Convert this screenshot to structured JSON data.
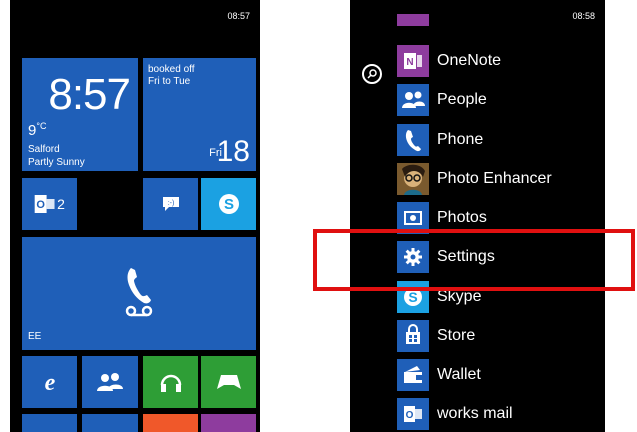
{
  "start_screen": {
    "status_time": "08:57",
    "clock_tile": {
      "time": "8:57",
      "temperature": "9",
      "temp_unit": "°C",
      "city": "Salford",
      "condition": "Partly Sunny"
    },
    "calendar_tile": {
      "line1": "booked off",
      "line2": "Fri to Tue",
      "day": "Fri",
      "date": "18"
    },
    "mail_tile": {
      "count": "2",
      "icon": "outlook-mail-icon"
    },
    "messaging_tile": {
      "icon": "messaging-icon"
    },
    "skype_tile": {
      "icon": "skype-icon"
    },
    "phone_tile": {
      "carrier": "EE",
      "icon": "phone-voicemail-icon"
    },
    "bottom_tiles": [
      "internet-explorer-icon",
      "people-icon",
      "music-headphones-icon",
      "games-controller-icon"
    ]
  },
  "app_list": {
    "status_time": "08:58",
    "apps": [
      {
        "label": "OneNote",
        "icon": "onenote-icon",
        "color": "#8e3c9e"
      },
      {
        "label": "People",
        "icon": "people-icon",
        "color": "#1f5fb8"
      },
      {
        "label": "Phone",
        "icon": "phone-icon",
        "color": "#1f5fb8"
      },
      {
        "label": "Photo Enhancer",
        "icon": "photo-enhancer-icon",
        "color": "#c99a52"
      },
      {
        "label": "Photos",
        "icon": "photos-icon",
        "color": "#1f5fb8"
      },
      {
        "label": "Settings",
        "icon": "settings-gear-icon",
        "color": "#1f5fb8"
      },
      {
        "label": "Skype",
        "icon": "skype-icon",
        "color": "#1ba1e2"
      },
      {
        "label": "Store",
        "icon": "store-icon",
        "color": "#1f5fb8"
      },
      {
        "label": "Wallet",
        "icon": "wallet-icon",
        "color": "#1f5fb8"
      },
      {
        "label": "works mail",
        "icon": "outlook-mail-icon",
        "color": "#1f5fb8"
      }
    ]
  },
  "highlight_color": "#e01010"
}
